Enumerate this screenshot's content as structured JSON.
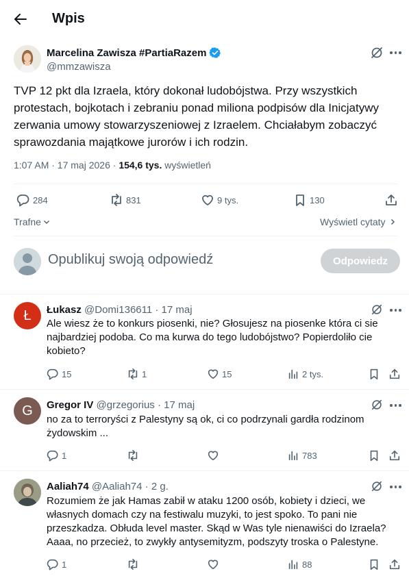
{
  "header": {
    "title": "Wpis"
  },
  "post": {
    "author_name": "Marcelina Zawisza #PartiaRazem",
    "handle": "@mmzawisza",
    "text": "TVP 12 pkt dla Izraela, który dokonał ludobójstwa. Przy wszystkich protestach, bojkotach i zebraniu ponad miliona podpisów dla Inicjatywy zerwania umowy stowarzyszeniowej z Izraelem. Chciałabym zobaczyć sprawozdania majątkowe jurorów i ich rodzin.",
    "time": "1:07 AM · 17 maj 2026 · ",
    "views": "154,6 tys.",
    "views_label": " wyświetleń",
    "stats": {
      "replies": "284",
      "reposts": "831",
      "likes": "9 tys.",
      "bookmarks": "130"
    }
  },
  "sort": {
    "label": "Trafne",
    "quotes_link": "Wyświetl cytaty"
  },
  "composer": {
    "placeholder": "Opublikuj swoją odpowiedź",
    "button": "Odpowiedz"
  },
  "replies": [
    {
      "name": "Łukasz",
      "handle": "@Domi136611",
      "time": "· 17 maj",
      "avatar_letter": "Ł",
      "avatar_color": "#d32f17",
      "text": "Ale wiesz że to konkurs piosenki, nie? Głosujesz na piosenke która ci sie najbardziej podoba. Co ma kurwa do tego ludobójstwo? Popierdoliło cie kobieto?",
      "replies": "15",
      "reposts": "1",
      "likes": "15",
      "views": "2 tys."
    },
    {
      "name": "Gregor IV",
      "handle": "@grzegorius",
      "time": "· 17 maj",
      "avatar_letter": "G",
      "avatar_color": "#7b5a52",
      "text": "no za to terroryści z Palestyny są ok, ci co podrzynali gardła rodzinom żydowskim ...",
      "replies": "1",
      "reposts": "",
      "likes": "",
      "views": "783"
    },
    {
      "name": "Aaliah74",
      "handle": "@Aaliah74",
      "time": "· 2 g.",
      "avatar_letter": "",
      "avatar_color": "#8a8f7a",
      "text": "Rozumiem że jak Hamas zabił w ataku 1200 osób, kobiety i dzieci, we własnych domach czy na festiwalu muzyki, to jest spoko. To pani nie przeszkadza. Obłuda level master. Skąd w Was tyle nienawiści do Izraela? Aaaa, no przecież, to zwykły antysemityzm, podszyty troska o Palestyne.",
      "replies": "1",
      "reposts": "",
      "likes": "",
      "views": "88"
    }
  ],
  "colors": {
    "accent": "#1d9bf0",
    "text": "#0f1419",
    "muted": "#536471",
    "border": "#eff3f4",
    "button_disabled": "#cfd3d5"
  }
}
